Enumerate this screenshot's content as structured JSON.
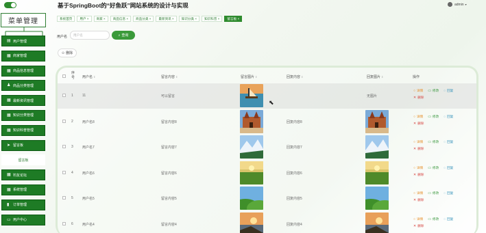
{
  "header": {
    "title": "基于SpringBoot的“好鱼跃”网站系统的设计与实现",
    "user": "admin"
  },
  "sidebar": {
    "title": "菜单管理",
    "items": [
      {
        "label": "用户管理",
        "icon": "user-icon"
      },
      {
        "label": "商家管理",
        "icon": "grid-icon"
      },
      {
        "label": "商品信息管理",
        "icon": "grid-icon"
      },
      {
        "label": "商品分类管理",
        "icon": "person-icon"
      },
      {
        "label": "最新资讯管理",
        "icon": "grid-icon"
      },
      {
        "label": "知识分类管理",
        "icon": "grid-icon"
      },
      {
        "label": "知识科普管理",
        "icon": "grid-icon"
      },
      {
        "label": "留言板",
        "icon": "send-icon"
      },
      {
        "label": "留言板",
        "sub": true
      },
      {
        "label": "钓友论坛",
        "icon": "grid-icon"
      },
      {
        "label": "系统管理",
        "icon": "grid-icon"
      },
      {
        "label": "订单管理",
        "icon": "bars-icon"
      },
      {
        "label": "用户中心",
        "icon": "monitor-icon"
      }
    ]
  },
  "tabs": [
    {
      "label": "系统首页",
      "active": false
    },
    {
      "label": "用户 ×",
      "active": false
    },
    {
      "label": "商家 ×",
      "active": false
    },
    {
      "label": "商品信息 ×",
      "active": false
    },
    {
      "label": "商品分类 ×",
      "active": false
    },
    {
      "label": "最新资讯 ×",
      "active": false
    },
    {
      "label": "知识分类 ×",
      "active": false
    },
    {
      "label": "知识科普 ×",
      "active": false
    },
    {
      "label": "留言板 ×",
      "active": true
    }
  ],
  "search": {
    "label": "用户名",
    "placeholder": "用户名",
    "button": "查询"
  },
  "delete_button": "删除",
  "table": {
    "columns": [
      "序号",
      "用户名",
      "留言内容",
      "留言图片",
      "回复内容",
      "回复图片",
      "操作"
    ],
    "rows": [
      {
        "no": "1",
        "username": "11",
        "message": "可以留言",
        "image": "boat",
        "reply": "",
        "reply_image": "无图片"
      },
      {
        "no": "2",
        "username": "用户名8",
        "message": "留言内容8",
        "image": "castle",
        "reply": "回复内容8",
        "reply_image": "castle"
      },
      {
        "no": "3",
        "username": "用户名7",
        "message": "留言内容7",
        "image": "snow",
        "reply": "回复内容7",
        "reply_image": "snow"
      },
      {
        "no": "4",
        "username": "用户名6",
        "message": "留言内容6",
        "image": "field",
        "reply": "回复内容6",
        "reply_image": "field"
      },
      {
        "no": "5",
        "username": "用户名5",
        "message": "留言内容5",
        "image": "hills",
        "reply": "回复内容5",
        "reply_image": "hills"
      },
      {
        "no": "6",
        "username": "用户名4",
        "message": "留言内容4",
        "image": "coast",
        "reply": "回复内容4",
        "reply_image": "coast"
      }
    ],
    "actions": {
      "detail": "详情",
      "edit": "修改",
      "reply": "回复",
      "remove": "删除"
    }
  },
  "colors": {
    "primary": "#1e7b25",
    "accent": "#3a9a3a",
    "detail": "#e68a1f",
    "reply": "#2f8fb8",
    "remove": "#d64541"
  }
}
